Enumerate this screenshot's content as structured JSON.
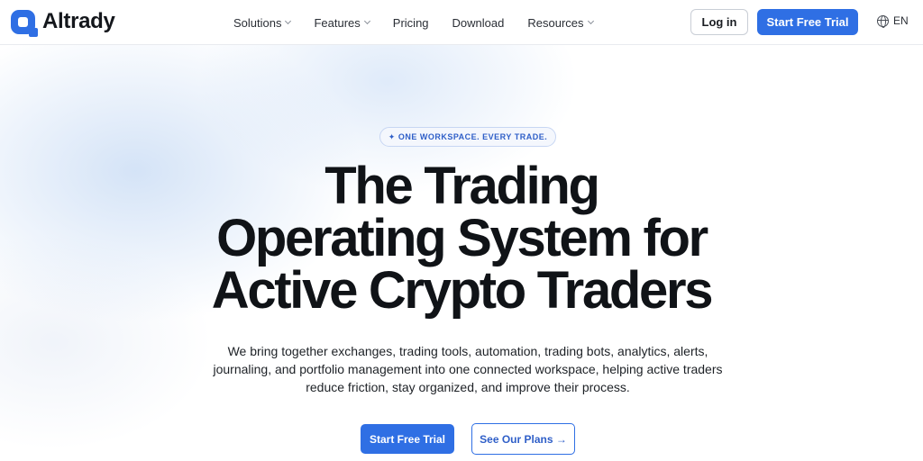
{
  "brand": {
    "name": "Altrady",
    "logo_icon": "altrady-logo-icon",
    "accent": "#2f6fe4"
  },
  "nav": {
    "items": [
      {
        "label": "Solutions",
        "has_dropdown": true
      },
      {
        "label": "Features",
        "has_dropdown": true
      },
      {
        "label": "Pricing",
        "has_dropdown": false
      },
      {
        "label": "Download",
        "has_dropdown": false
      },
      {
        "label": "Resources",
        "has_dropdown": true
      }
    ],
    "login_label": "Log in",
    "trial_label": "Start Free Trial",
    "language": "EN",
    "language_icon": "globe-icon"
  },
  "hero": {
    "badge": "✦ ONE WORKSPACE. EVERY TRADE.",
    "headline": [
      "The Trading",
      "Operating System for",
      "Active Crypto Traders"
    ],
    "subtext": "We bring together exchanges, trading tools, automation, trading bots, analytics, alerts, journaling, and portfolio management into one connected workspace, helping active traders reduce friction, stay organized, and improve their process.",
    "primary_cta": "Start Free Trial",
    "secondary_cta": "See Our Plans →"
  }
}
